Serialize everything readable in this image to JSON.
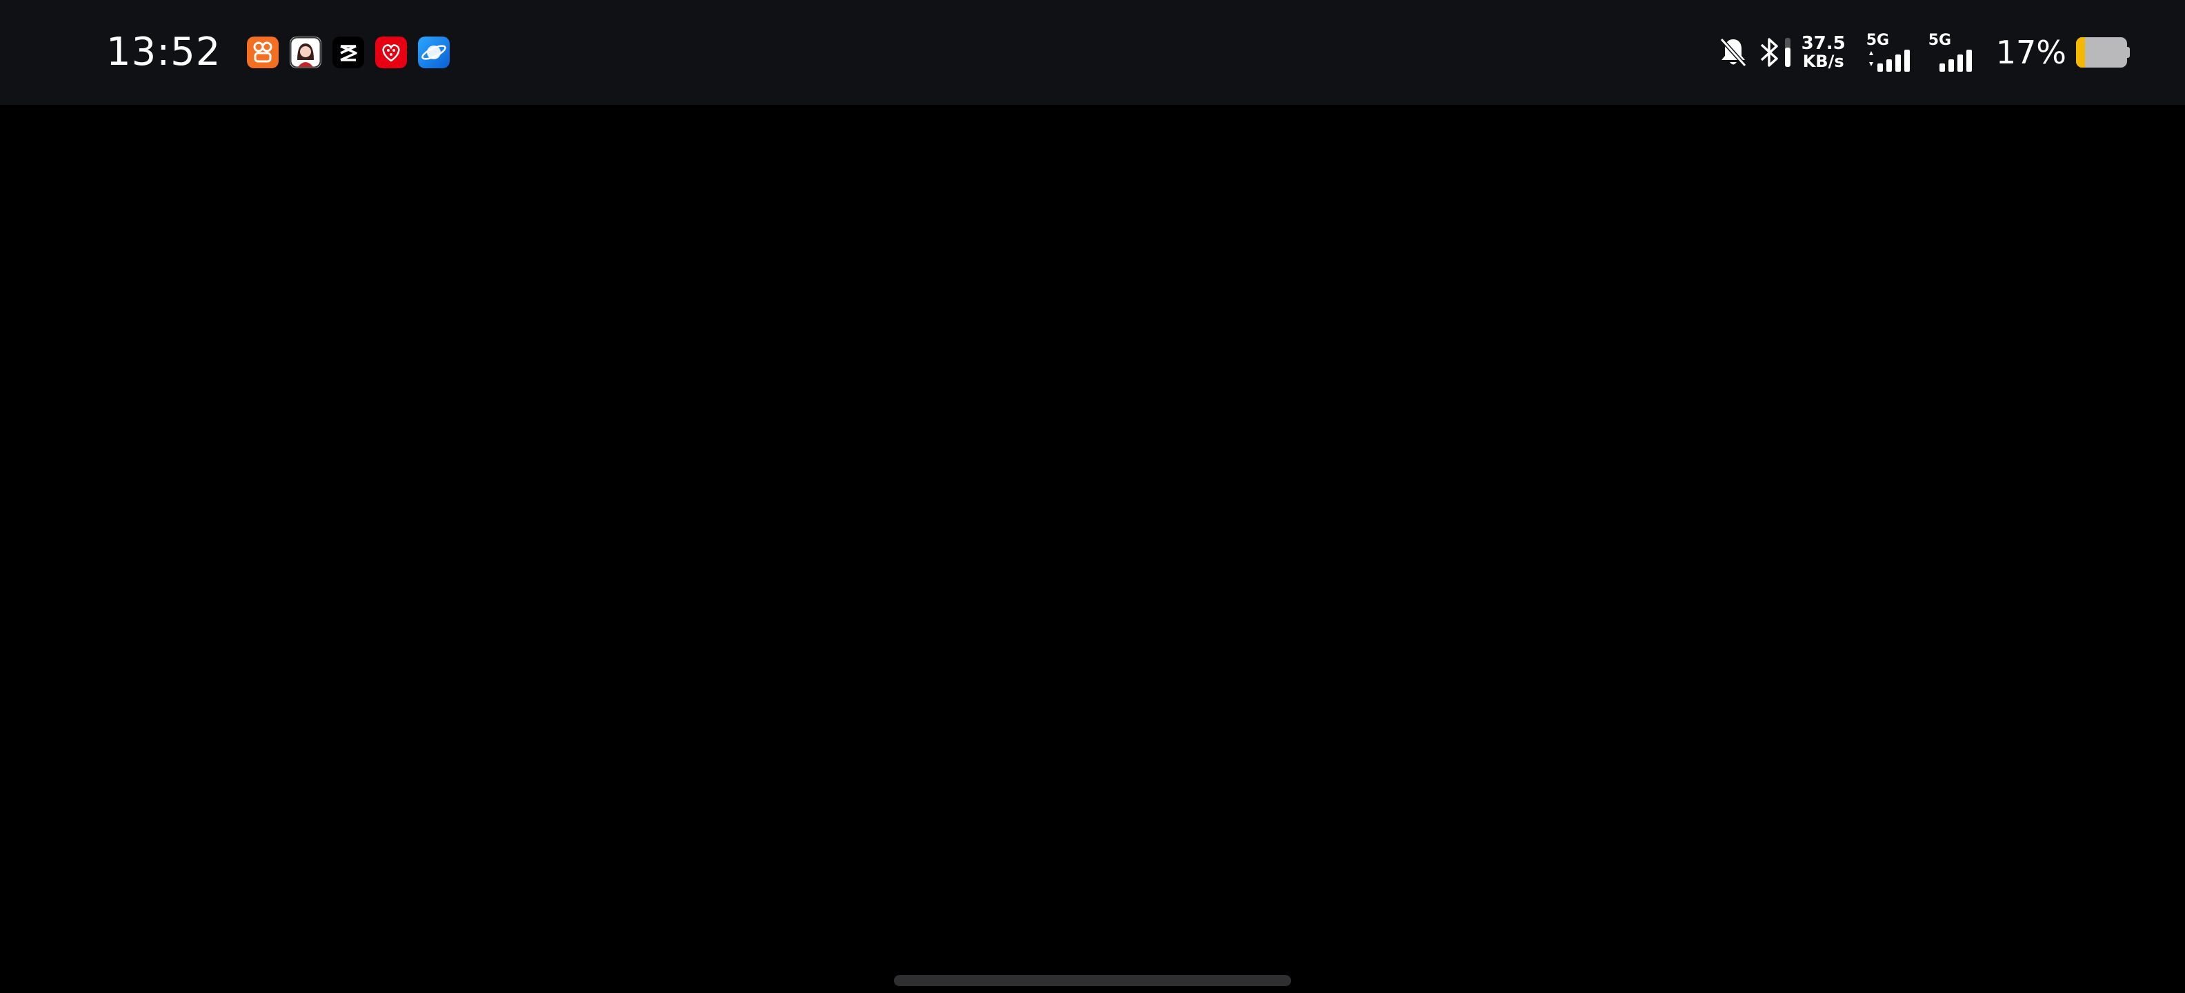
{
  "status_bar": {
    "time": "13:52",
    "notification_apps": [
      {
        "icon": "orange-chat-app-icon",
        "color": "#f36f21"
      },
      {
        "icon": "girl-avatar-app-icon",
        "color": "#ffffff"
      },
      {
        "icon": "capcut-app-icon",
        "color": "#000000"
      },
      {
        "icon": "red-heart-app-icon",
        "color": "#e60012"
      },
      {
        "icon": "blue-planet-browser-icon",
        "color": "#1e88e5"
      }
    ],
    "bell_muted_icon": "bell-muted-icon",
    "bluetooth_icon": "bluetooth-icon",
    "net_speed_value": "37.5",
    "net_speed_unit": "KB/s",
    "sim1_label": "5G",
    "sim2_label": "5G",
    "battery_percent_text": "17%",
    "battery_level": 0.17,
    "battery_fill_color": "#f5b800"
  },
  "screen_background": "#000000"
}
